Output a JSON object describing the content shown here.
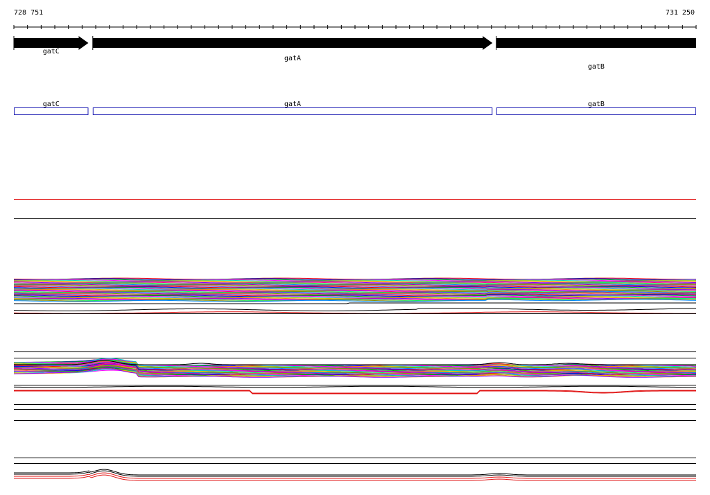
{
  "coordinates": {
    "start": "728 751",
    "end": "731 250"
  },
  "genomic_range": [
    728751,
    731250
  ],
  "genes": [
    {
      "name": "gatC",
      "start": 728751,
      "end": 729024,
      "strand": "+"
    },
    {
      "name": "gatA",
      "start": 729040,
      "end": 730504,
      "strand": "+"
    },
    {
      "name": "gatB",
      "start": 730518,
      "end": 731250,
      "strand": "+"
    }
  ],
  "colors": {
    "gene_arrow": "#000000",
    "gene_box": "#1f1fb4",
    "ruler": "#000000",
    "red_track": "#e01010",
    "baseline": "#000000"
  },
  "track_colors": [
    "#ff0000",
    "#0000ff",
    "#00b000",
    "#ff00ff",
    "#00cccc",
    "#cccc00",
    "#ff8800",
    "#8800ff",
    "#ff0088",
    "#00ff66",
    "#888800",
    "#0088ff",
    "#aa00aa",
    "#66aa00",
    "#ff5555",
    "#5555ff"
  ]
}
